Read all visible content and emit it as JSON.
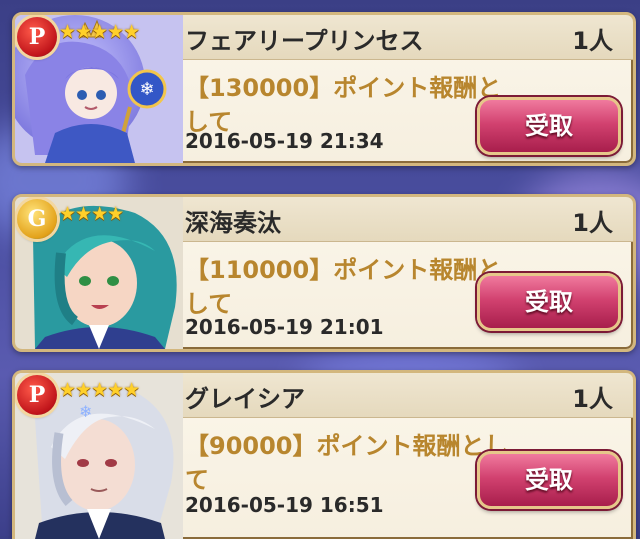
{
  "colors": {
    "accent": "#d24270",
    "gold_text": "#b8862e",
    "star": "#ffd02a"
  },
  "entries": [
    {
      "rarity": "P",
      "stars": "★★★★★",
      "name": "フェアリープリンセス",
      "count": "1人",
      "message": "【130000】ポイント報酬として",
      "date": "2016-05-19 21:34",
      "button": "受取",
      "portrait": "fairy-princess"
    },
    {
      "rarity": "G",
      "stars": "★★★★",
      "name": "深海奏汰",
      "count": "1人",
      "message": "【110000】ポイント報酬として",
      "date": "2016-05-19 21:01",
      "button": "受取",
      "portrait": "teal-haired-boy"
    },
    {
      "rarity": "P",
      "stars": "★★★★★",
      "name": "グレイシア",
      "count": "1人",
      "message": "【90000】ポイント報酬として",
      "date": "2016-05-19 16:51",
      "button": "受取",
      "portrait": "silver-haired-man"
    }
  ]
}
